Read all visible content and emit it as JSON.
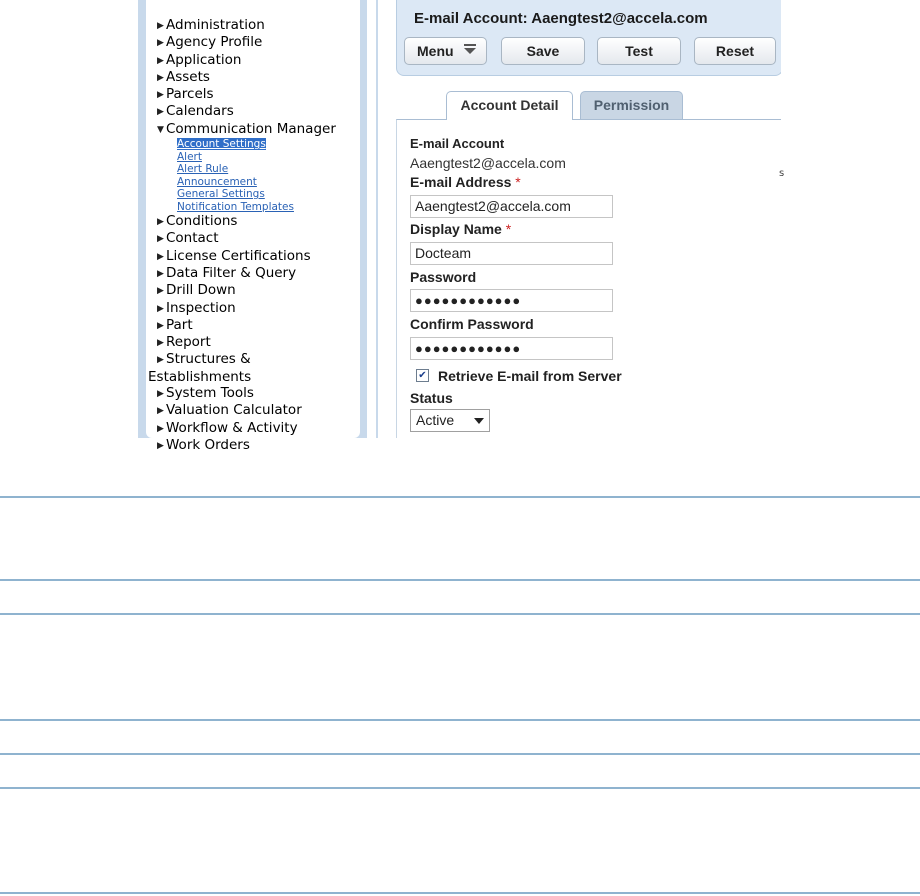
{
  "nav": {
    "items": [
      {
        "label": "Administration"
      },
      {
        "label": "Agency Profile"
      },
      {
        "label": "Application"
      },
      {
        "label": "Assets"
      },
      {
        "label": "Parcels"
      },
      {
        "label": "Calendars"
      },
      {
        "label": "Communication Manager",
        "expanded": true
      },
      {
        "label": "Conditions"
      },
      {
        "label": "Contact"
      },
      {
        "label": "License Certifications"
      },
      {
        "label": "Data Filter & Query"
      },
      {
        "label": "Drill Down"
      },
      {
        "label": "Inspection"
      },
      {
        "label": "Part"
      },
      {
        "label": "Report"
      },
      {
        "label": "Structures &"
      },
      {
        "label": "System Tools"
      },
      {
        "label": "Valuation Calculator"
      },
      {
        "label": "Workflow & Activity"
      },
      {
        "label": "Work Orders"
      }
    ],
    "structures_line2": "Establishments",
    "sub_items": [
      {
        "label": "Account Settings",
        "selected": true
      },
      {
        "label": "Alert"
      },
      {
        "label": "Alert Rule"
      },
      {
        "label": "Announcement"
      },
      {
        "label": "General Settings"
      },
      {
        "label": "Notification Templates"
      }
    ]
  },
  "header": {
    "title": "E-mail Account: Aaengtest2@accela.com",
    "menu_label": "Menu",
    "save_label": "Save",
    "test_label": "Test",
    "reset_label": "Reset"
  },
  "tabs": {
    "detail": "Account Detail",
    "permission": "Permission"
  },
  "form": {
    "account_label": "E-mail Account",
    "account_value": "Aaengtest2@accela.com",
    "address_label": "E-mail Address",
    "address_value": "Aaengtest2@accela.com",
    "display_label": "Display Name",
    "display_value": "Docteam",
    "password_label": "Password",
    "password_value": "●●●●●●●●●●●●",
    "confirm_label": "Confirm Password",
    "confirm_value": "●●●●●●●●●●●●",
    "retrieve_label": "Retrieve E-mail from Server",
    "retrieve_checked": true,
    "status_label": "Status",
    "status_value": "Active",
    "required_mark": "*"
  },
  "colors": {
    "nav_bg": "#c8d9eb",
    "link": "#2a62b5",
    "selected_bg": "#2f6ec8",
    "header_bg": "#dce8f5",
    "rule": "#8fb3cf"
  }
}
